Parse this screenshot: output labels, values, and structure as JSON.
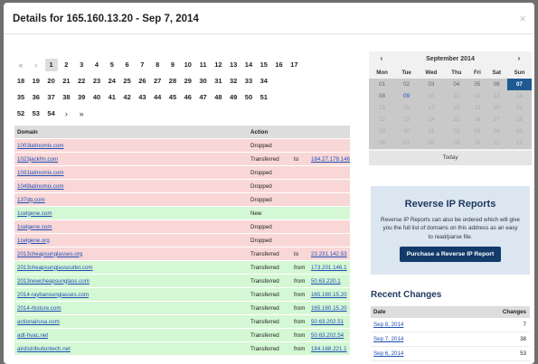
{
  "modal": {
    "title": "Details for 165.160.13.20 - Sep 7, 2014",
    "close_icon": "×"
  },
  "pager": {
    "first": "«",
    "prev": "‹",
    "next": "›",
    "last": "»",
    "active": "1",
    "rows": [
      [
        "1",
        "2",
        "3",
        "4",
        "5",
        "6",
        "7",
        "8",
        "9",
        "10",
        "11",
        "12",
        "13",
        "14",
        "15",
        "16",
        "17"
      ],
      [
        "18",
        "19",
        "20",
        "21",
        "22",
        "23",
        "24",
        "25",
        "26",
        "27",
        "28",
        "29",
        "30",
        "31",
        "32",
        "33",
        "34"
      ],
      [
        "35",
        "36",
        "37",
        "38",
        "39",
        "40",
        "41",
        "42",
        "43",
        "44",
        "45",
        "46",
        "47",
        "48",
        "49",
        "50",
        "51"
      ],
      [
        "52",
        "53",
        "54"
      ]
    ]
  },
  "table": {
    "headers": {
      "domain": "Domain",
      "action": "Action"
    },
    "rows": [
      {
        "domain": "1003latinomix.com",
        "action": "Dropped",
        "dir": "",
        "ip": "",
        "status": "dropped"
      },
      {
        "domain": "1023jackfm.com",
        "action": "Transferred",
        "dir": "to",
        "ip": "184.27.178.146",
        "status": "dropped"
      },
      {
        "domain": "1031latinomix.com",
        "action": "Dropped",
        "dir": "",
        "ip": "",
        "status": "dropped"
      },
      {
        "domain": "1049latinomix.com",
        "action": "Dropped",
        "dir": "",
        "ip": "",
        "status": "dropped"
      },
      {
        "domain": "137dg.com",
        "action": "Dropped",
        "dir": "",
        "ip": "",
        "status": "dropped"
      },
      {
        "domain": "1celgene.com",
        "action": "New",
        "dir": "",
        "ip": "",
        "status": "new"
      },
      {
        "domain": "1celgene.com",
        "action": "Dropped",
        "dir": "",
        "ip": "",
        "status": "dropped"
      },
      {
        "domain": "1celgene.org",
        "action": "Dropped",
        "dir": "",
        "ip": "",
        "status": "dropped"
      },
      {
        "domain": "2013cheapsunglasses.org",
        "action": "Transferred",
        "dir": "to",
        "ip": "23.231.142.53",
        "status": "dropped"
      },
      {
        "domain": "2013cheapsunglassoutlet.com",
        "action": "Transferred",
        "dir": "from",
        "ip": "173.201.146.1",
        "status": "new"
      },
      {
        "domain": "2013newcheapsunglass.com",
        "action": "Transferred",
        "dir": "from",
        "ip": "50.63.220.1",
        "status": "new"
      },
      {
        "domain": "2014-raybansunglasses.com",
        "action": "Transferred",
        "dir": "from",
        "ip": "165.160.15.20",
        "status": "new"
      },
      {
        "domain": "2014-rbstore.com",
        "action": "Transferred",
        "dir": "from",
        "ip": "165.160.15.20",
        "status": "new"
      },
      {
        "domain": "actionairusa.com",
        "action": "Transferred",
        "dir": "from",
        "ip": "50.63.202.51",
        "status": "new"
      },
      {
        "domain": "adt-hvac.net",
        "action": "Transferred",
        "dir": "from",
        "ip": "50.63.202.54",
        "status": "new"
      },
      {
        "domain": "airdistributiontech.net",
        "action": "Transferred",
        "dir": "from",
        "ip": "184.168.221.1",
        "status": "new"
      }
    ]
  },
  "calendar": {
    "prev": "‹",
    "next": "›",
    "title": "September 2014",
    "days": [
      "Mon",
      "Tue",
      "Wed",
      "Thu",
      "Fri",
      "Sat",
      "Sun"
    ],
    "weeks": [
      [
        {
          "d": "01",
          "t": "cur"
        },
        {
          "d": "02",
          "t": "cur"
        },
        {
          "d": "03",
          "t": "cur"
        },
        {
          "d": "04",
          "t": "cur"
        },
        {
          "d": "05",
          "t": "cur"
        },
        {
          "d": "06",
          "t": "cur"
        },
        {
          "d": "07",
          "t": "hl"
        }
      ],
      [
        {
          "d": "08",
          "t": "cur"
        },
        {
          "d": "09",
          "t": "blue"
        },
        {
          "d": "10",
          "t": "dim"
        },
        {
          "d": "11",
          "t": "dim"
        },
        {
          "d": "12",
          "t": "dim"
        },
        {
          "d": "13",
          "t": "dim"
        },
        {
          "d": "14",
          "t": "dim"
        }
      ],
      [
        {
          "d": "15",
          "t": "dim"
        },
        {
          "d": "16",
          "t": "dim"
        },
        {
          "d": "17",
          "t": "dim"
        },
        {
          "d": "18",
          "t": "dim"
        },
        {
          "d": "19",
          "t": "dim"
        },
        {
          "d": "20",
          "t": "dim"
        },
        {
          "d": "21",
          "t": "dim"
        }
      ],
      [
        {
          "d": "22",
          "t": "dim"
        },
        {
          "d": "23",
          "t": "dim"
        },
        {
          "d": "24",
          "t": "dim"
        },
        {
          "d": "25",
          "t": "dim"
        },
        {
          "d": "26",
          "t": "dim"
        },
        {
          "d": "27",
          "t": "dim"
        },
        {
          "d": "28",
          "t": "dim"
        }
      ],
      [
        {
          "d": "29",
          "t": "dim"
        },
        {
          "d": "30",
          "t": "dim"
        },
        {
          "d": "01",
          "t": "dim"
        },
        {
          "d": "02",
          "t": "dim"
        },
        {
          "d": "03",
          "t": "dim"
        },
        {
          "d": "04",
          "t": "dim"
        },
        {
          "d": "05",
          "t": "dim"
        }
      ],
      [
        {
          "d": "06",
          "t": "dim"
        },
        {
          "d": "07",
          "t": "dim"
        },
        {
          "d": "08",
          "t": "dim"
        },
        {
          "d": "09",
          "t": "dim"
        },
        {
          "d": "10",
          "t": "dim"
        },
        {
          "d": "11",
          "t": "dim"
        },
        {
          "d": "12",
          "t": "dim"
        }
      ]
    ],
    "today": "Today"
  },
  "reverse_ip": {
    "title": "Reverse IP Reports",
    "text": "Reverse IP Reports can also be ordered which will give you the full list of domains on this address as an easy to read/parse file.",
    "button": "Purchase a Reverse IP Report"
  },
  "recent": {
    "title": "Recent Changes",
    "headers": {
      "date": "Date",
      "changes": "Changes"
    },
    "rows": [
      {
        "date": "Sep 8, 2014",
        "changes": "7"
      },
      {
        "date": "Sep 7, 2014",
        "changes": "38"
      },
      {
        "date": "Sep 6, 2014",
        "changes": "53"
      }
    ]
  },
  "colors": {
    "dropped_row": "#f9d7d7",
    "new_row": "#d4f7d4",
    "accent": "#1f5994",
    "link": "#1e4fb5"
  }
}
